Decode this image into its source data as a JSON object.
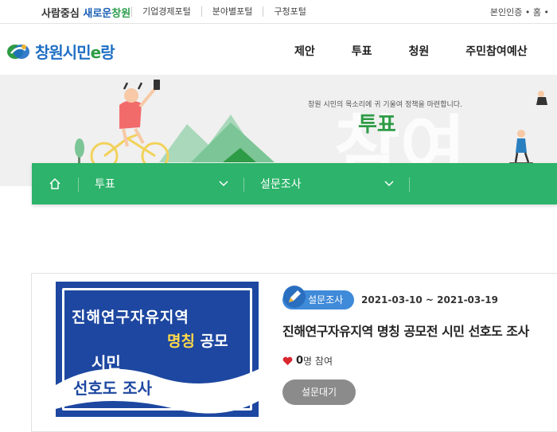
{
  "topbar": {
    "slogan_a": "사람중심 ",
    "slogan_b": "새로운",
    "slogan_c": "창원",
    "links": [
      "기업경제포털",
      "분야별포털",
      "구청포털"
    ],
    "util": "본인인증 • 홈 •"
  },
  "header": {
    "logo_a": "창원시민",
    "logo_b": "e",
    "logo_c": "랑",
    "nav": [
      "제안",
      "투표",
      "청원",
      "주민참여예산"
    ]
  },
  "hero": {
    "subtitle": "창원 시민의 목소리에 귀 기울여 정책을 마련합니다.",
    "title": "투표",
    "bg_text": "참여"
  },
  "breadcrumb": {
    "level1": "투표",
    "level2": "설문조사"
  },
  "card": {
    "thumbnail": {
      "line1": "진해연구자유지역",
      "line2_a": "명칭",
      "line2_b": "공모",
      "line3": "시민",
      "line4": "선호도 조사"
    },
    "badge": "설문조사",
    "date": "2021-03-10 ~ 2021-03-19",
    "title": "진해연구자유지역 명칭 공모전 시민 선호도 조사",
    "participants_count": "0",
    "participants_label": "명 참여",
    "status": "설문대기"
  },
  "colors": {
    "green": "#2db36b",
    "blue": "#3f8ad9",
    "thumb_bg": "#1d47a0"
  }
}
